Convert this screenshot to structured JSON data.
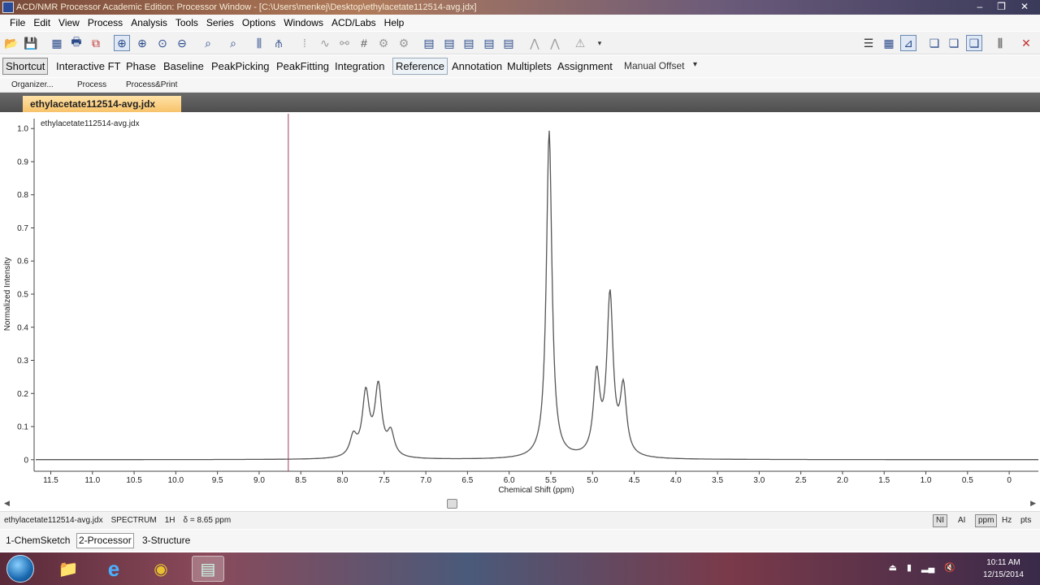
{
  "window": {
    "title": "ACD/NMR Processor Academic Edition: Processor Window - [C:\\Users\\menkej\\Desktop\\ethylacetate112514-avg.jdx]",
    "controls": {
      "minimize": "–",
      "restore": "❐",
      "close": "✕"
    }
  },
  "menu": [
    "File",
    "Edit",
    "View",
    "Process",
    "Analysis",
    "Tools",
    "Series",
    "Options",
    "Windows",
    "ACD/Labs",
    "Help"
  ],
  "mode_toolbar": {
    "shortcut": "Shortcut",
    "items": [
      "Interactive FT",
      "Phase",
      "Baseline",
      "PeakPicking",
      "PeakFitting",
      "Integration",
      "Reference",
      "Annotation",
      "Multiplets",
      "Assignment"
    ],
    "manual_offset": "Manual Offset",
    "overflow": "▾"
  },
  "sub_toolbar": [
    "Organizer...",
    "Process",
    "Process&Print"
  ],
  "document_tab": "ethylacetate112514-avg.jdx",
  "chart_data": {
    "type": "line",
    "title": "ethylacetate112514-avg.jdx",
    "xlabel": "Chemical Shift (ppm)",
    "ylabel": "Normalized Intensity",
    "xlim": [
      11.7,
      -0.35
    ],
    "ylim": [
      -0.03,
      1.03
    ],
    "x_ticks": [
      "11.5",
      "11.0",
      "10.5",
      "10.0",
      "9.5",
      "9.0",
      "8.5",
      "8.0",
      "7.5",
      "7.0",
      "6.5",
      "6.0",
      "5.5",
      "5.0",
      "4.5",
      "4.0",
      "3.5",
      "3.0",
      "2.5",
      "2.0",
      "1.5",
      "1.0",
      "0.5",
      "0"
    ],
    "y_ticks": [
      "1.0",
      "0.9",
      "0.8",
      "0.7",
      "0.6",
      "0.5",
      "0.4",
      "0.3",
      "0.2",
      "0.1",
      "0"
    ],
    "cursor_ppm": 8.65,
    "peaks": [
      {
        "ppm": 7.87,
        "height": 0.06,
        "width": 0.05
      },
      {
        "ppm": 7.72,
        "height": 0.19,
        "width": 0.05
      },
      {
        "ppm": 7.57,
        "height": 0.21,
        "width": 0.05
      },
      {
        "ppm": 7.42,
        "height": 0.07,
        "width": 0.05
      },
      {
        "ppm": 5.52,
        "height": 0.99,
        "width": 0.04
      },
      {
        "ppm": 4.95,
        "height": 0.24,
        "width": 0.045
      },
      {
        "ppm": 4.79,
        "height": 0.48,
        "width": 0.045
      },
      {
        "ppm": 4.63,
        "height": 0.2,
        "width": 0.045
      }
    ],
    "colors": {
      "trace": "#555555",
      "cursor": "#a04060"
    }
  },
  "status": {
    "file": "ethylacetate112514-avg.jdx",
    "type": "SPECTRUM",
    "nucleus": "1H",
    "delta": "δ = 8.65 ppm",
    "buttons": [
      "NI",
      "AI",
      "ppm",
      "Hz",
      "pts"
    ]
  },
  "modules": [
    "1-ChemSketch",
    "2-Processor",
    "3-Structure"
  ],
  "taskbar": {
    "apps": [
      "📁",
      "e",
      "◉",
      "▤"
    ],
    "time": "10:11 AM",
    "date": "12/15/2014"
  }
}
